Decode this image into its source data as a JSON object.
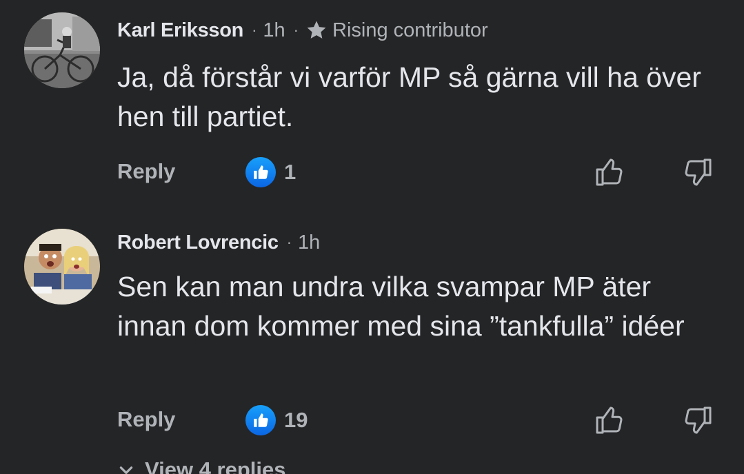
{
  "comments": [
    {
      "author": "Karl Eriksson",
      "separator": "·",
      "time": "1h",
      "badge": "Rising contributor",
      "text": "Ja, då förstår vi varför MP så gärna vill ha över hen till partiet.",
      "reply_label": "Reply",
      "like_count": "1",
      "avatar_icon": "avatar-photo-bicycle"
    },
    {
      "author": "Robert Lovrencic",
      "separator": "·",
      "time": "1h",
      "text": "Sen kan man undra vilka svampar MP äter innan dom kommer med sina ”tankfulla” idéer",
      "reply_label": "Reply",
      "like_count": "19",
      "avatar_icon": "avatar-photo-couple"
    }
  ],
  "view_replies_label": "View 4 replies",
  "colors": {
    "background": "#242526",
    "primary_text": "#e4e6eb",
    "secondary_text": "#b0b3b8",
    "like_blue": "#1877f2"
  },
  "icons": {
    "like_reaction": "like-reaction-icon",
    "thumb_up": "thumb-up-outline-icon",
    "thumb_down": "thumb-down-outline-icon",
    "star": "star-icon",
    "chevron": "chevron-down-icon"
  }
}
